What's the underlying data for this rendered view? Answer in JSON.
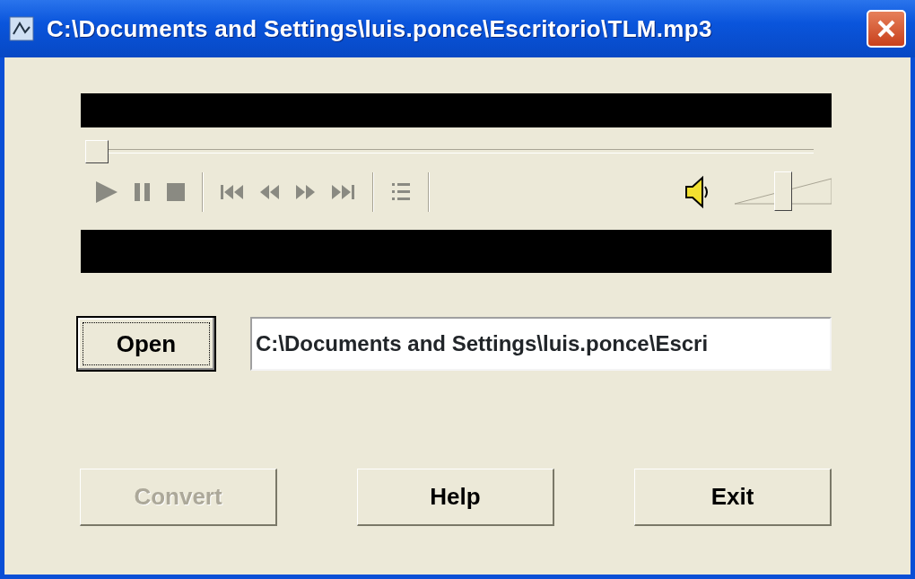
{
  "window": {
    "title": "C:\\Documents and Settings\\luis.ponce\\Escritorio\\TLM.mp3"
  },
  "seek": {
    "level": 0
  },
  "volume": {
    "level": 0.5
  },
  "open_button": {
    "label": "Open",
    "focused": true
  },
  "file_field": {
    "value": "C:\\Documents and Settings\\luis.ponce\\Escri"
  },
  "buttons": [
    {
      "label": "Convert",
      "disabled": true
    },
    {
      "label": "Help",
      "disabled": false
    },
    {
      "label": "Exit",
      "disabled": false
    }
  ]
}
